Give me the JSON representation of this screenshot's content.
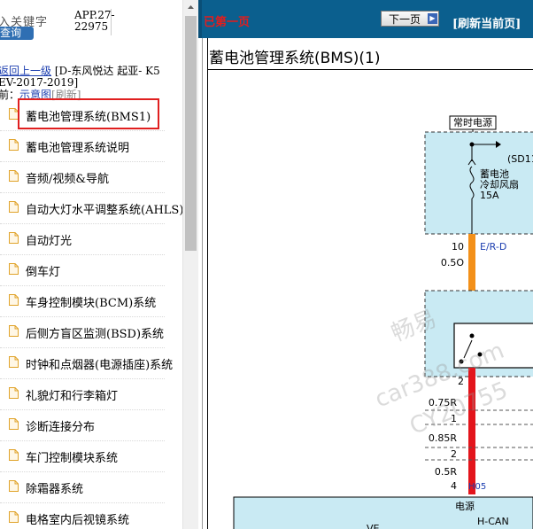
{
  "left_pane": {
    "search_hint": "入关键字",
    "query_label": "查询",
    "app_code": "APP.27-22975",
    "breadcrumb_back": "返回上一级",
    "breadcrumb_path": "[D-东风悦达 起亚- K5",
    "breadcrumb_path2": "EV-2017-2019]",
    "current_prefix": "前：",
    "schematic_link": "示意图",
    "refresh_link": "[刷新]",
    "menu_items": [
      "蓄电池管理系统(BMS1)",
      "蓄电池管理系统说明",
      "音频/视频&导航",
      "自动大灯水平调整系统(AHLS)",
      "自动灯光",
      "倒车灯",
      "车身控制模块(BCM)系统",
      "后侧方盲区监测(BSD)系统",
      "时钟和点烟器(电源插座)系统",
      "礼貌灯和行李箱灯",
      "诊断连接分布",
      "车门控制模块系统",
      "除霜器系统",
      "电格室内后视镜系统"
    ]
  },
  "toolbar": {
    "prev_label": "已第一页",
    "next_label": "下一页",
    "refresh_label": "[刷新当前页]"
  },
  "diagram": {
    "title": "蓄电池管理系统(BMS)(1)",
    "power_label": "常时电源",
    "fuse_code": "(SD11",
    "fuse_name_1": "蓄电池",
    "fuse_name_2": "冷却风扇",
    "fuse_rating": "15A",
    "pin_10": "10",
    "wire_color_1": "E/R-D",
    "wire_size_1": "0.5O",
    "pin_2": "2",
    "wire_size_2": "0.75R",
    "pin_1": "1",
    "wire_size_3": "0.85R",
    "pin_2b": "2",
    "wire_size_4": "0.5R",
    "pin_4": "4",
    "connector": "H05",
    "power_source": "电源",
    "hcan": "H-CAN",
    "bottom_label": "VE",
    "watermark_1": "畅易",
    "watermark_2": "car388.com",
    "watermark_3": "CY20755",
    "colors": {
      "box_fill": "#c9eaf3",
      "wire_orange": "#f39019",
      "wire_red": "#e3151c",
      "topbar": "#0b5f8e"
    }
  }
}
